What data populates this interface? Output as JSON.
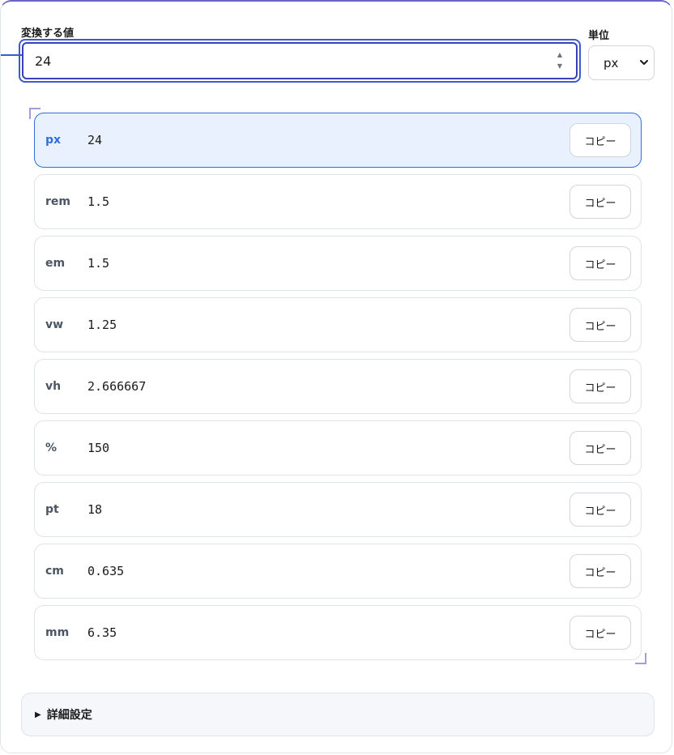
{
  "form": {
    "value_label": "変換する値",
    "value": "24",
    "unit_label": "単位",
    "unit_selected": "px"
  },
  "results": [
    {
      "unit": "px",
      "value": "24",
      "copy_label": "コピー",
      "active": true
    },
    {
      "unit": "rem",
      "value": "1.5",
      "copy_label": "コピー",
      "active": false
    },
    {
      "unit": "em",
      "value": "1.5",
      "copy_label": "コピー",
      "active": false
    },
    {
      "unit": "vw",
      "value": "1.25",
      "copy_label": "コピー",
      "active": false
    },
    {
      "unit": "vh",
      "value": "2.666667",
      "copy_label": "コピー",
      "active": false
    },
    {
      "unit": "%",
      "value": "150",
      "copy_label": "コピー",
      "active": false
    },
    {
      "unit": "pt",
      "value": "18",
      "copy_label": "コピー",
      "active": false
    },
    {
      "unit": "cm",
      "value": "0.635",
      "copy_label": "コピー",
      "active": false
    },
    {
      "unit": "mm",
      "value": "6.35",
      "copy_label": "コピー",
      "active": false
    }
  ],
  "details": {
    "label": "詳細設定",
    "icon": "triangle-right-icon"
  },
  "colors": {
    "accent": "#3b5bd1",
    "active_row_bg": "#e8f1fd",
    "active_unit": "#2f6fdb"
  }
}
